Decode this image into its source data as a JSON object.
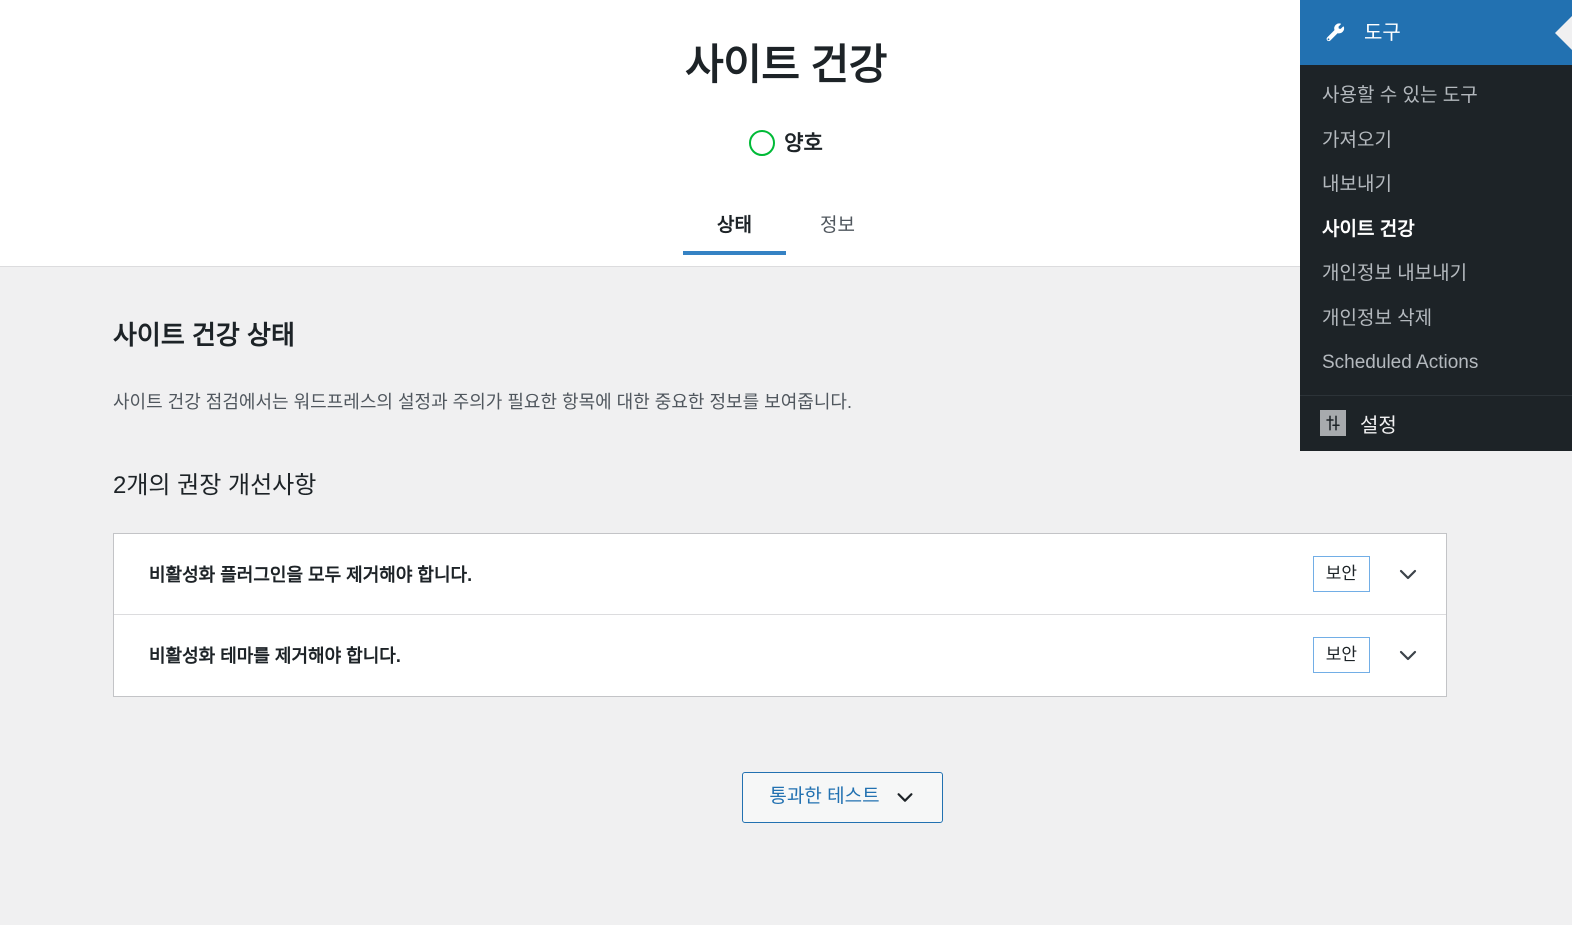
{
  "header": {
    "title": "사이트 건강",
    "status_label": "양호",
    "status_color": "#00ba37",
    "tabs": [
      {
        "label": "상태",
        "active": true
      },
      {
        "label": "정보",
        "active": false
      }
    ]
  },
  "main": {
    "section_title": "사이트 건강 상태",
    "section_description": "사이트 건강 점검에서는 워드프레스의 설정과 주의가 필요한 항목에 대한 중요한 정보를 보여줍니다.",
    "issues_heading": "2개의 권장 개선사항",
    "issues": [
      {
        "title": "비활성화 플러그인을 모두 제거해야 합니다.",
        "badge": "보안"
      },
      {
        "title": "비활성화 테마를 제거해야 합니다.",
        "badge": "보안"
      }
    ],
    "passed_tests_label": "통과한 테스트"
  },
  "admin_submenu": {
    "header_label": "도구",
    "header_icon": "wrench-icon",
    "header_color": "#2271b1",
    "items": [
      {
        "label": "사용할 수 있는 도구",
        "current": false
      },
      {
        "label": "가져오기",
        "current": false
      },
      {
        "label": "내보내기",
        "current": false
      },
      {
        "label": "사이트 건강",
        "current": true
      },
      {
        "label": "개인정보 내보내기",
        "current": false
      },
      {
        "label": "개인정보 삭제",
        "current": false
      },
      {
        "label": "Scheduled Actions",
        "current": false
      }
    ],
    "footer_label": "설정",
    "footer_icon": "sliders-icon"
  }
}
